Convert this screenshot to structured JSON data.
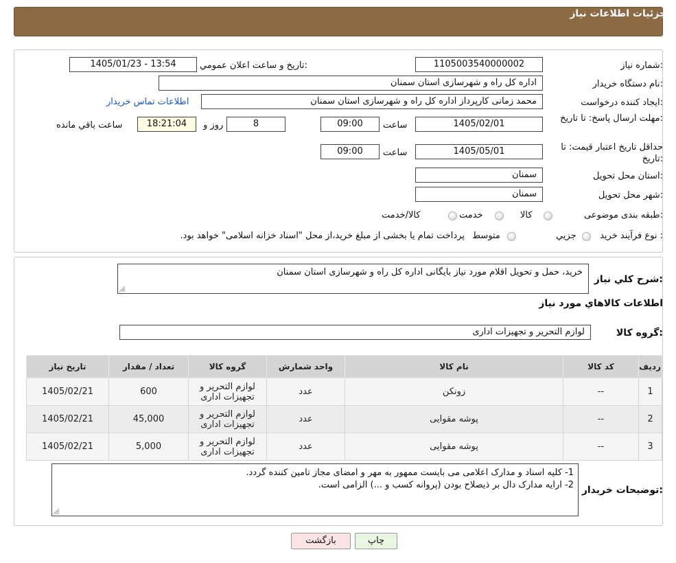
{
  "header": {
    "title": "جزئیات اطلاعات نیاز"
  },
  "info": {
    "need_number_label": "شماره نیاز:",
    "need_number": "1105003540000002",
    "announce_label": "تاریخ و ساعت اعلان عمومي:",
    "announce_value": "1405/01/23 - 13:54",
    "buyer_org_label": "نام دستگاه خريدار:",
    "buyer_org": "اداره کل راه و شهرسازی استان سمنان",
    "requester_label": "ايجاد کننده درخواست:",
    "requester": "محمد زمانی کارپرداز اداره کل راه و شهرسازی استان سمنان",
    "contact_link": "اطلاعات تماس خريدار",
    "deadline_label": "مهلت ارسال پاسخ: تا تاريخ:",
    "deadline_date": "1405/02/01",
    "time_label": "ساعت",
    "deadline_time": "09:00",
    "days_value": "8",
    "days_label": "روز و",
    "remaining_time": "18:21:04",
    "remaining_label": "ساعت باقي مانده",
    "validity_label": "حداقل تاريخ اعتبار قيمت: تا تاريخ:",
    "validity_date": "1405/05/01",
    "validity_time": "09:00",
    "province_label": "استان محل تحويل:",
    "province": "سمنان",
    "city_label": "شهر محل تحويل:",
    "city": "سمنان",
    "category_label": "طبقه بندی موضوعی:",
    "category_options": [
      "کالا",
      "خدمت",
      "کالا/خدمت"
    ],
    "process_label": "نوع فرآيند خريد :",
    "process_options": [
      "جزيي",
      "متوسط"
    ],
    "payment_note": "پرداخت تمام يا بخشی از مبلغ خريد،از محل \"اسناد خزانه اسلامی\" خواهد بود."
  },
  "details": {
    "description_label": "شرح کلي نياز:",
    "description": "خرید، حمل و تحویل اقلام مورد نیاز بایگانی اداره کل راه و شهرسازی استان سمنان",
    "goods_info_title": "اطلاعات کالاهاي مورد نياز",
    "goods_group_label": "گروه کالا:",
    "goods_group": "لوازم التحرير و تجهيزات اداری",
    "table": {
      "headers": [
        "رديف",
        "کد کالا",
        "نام کالا",
        "واحد شمارش",
        "گروه کالا",
        "تعداد / مقدار",
        "تاريخ نياز"
      ],
      "rows": [
        [
          "1",
          "--",
          "زونکن",
          "عدد",
          "لوازم التحرير و تجهيزات اداری",
          "600",
          "1405/02/21"
        ],
        [
          "2",
          "--",
          "پوشه مقوایی",
          "عدد",
          "لوازم التحرير و تجهيزات اداری",
          "45,000",
          "1405/02/21"
        ],
        [
          "3",
          "--",
          "پوشه مقوایی",
          "عدد",
          "لوازم التحرير و تجهيزات اداری",
          "5,000",
          "1405/02/21"
        ]
      ]
    },
    "buyer_notes_label": "توضيحات خريدار:",
    "buyer_notes_line1": "1- کلیه اسناد و مدارک اعلامی می بایست ممهور به مهر و امضای مجاز تامین کننده گردد.",
    "buyer_notes_line2": "2- ارایه مدارک دال بر ذیصلاح بودن (پروانه کسب و ...) الزامی است."
  },
  "buttons": {
    "print": "چاپ",
    "back": "بازگشت"
  },
  "colors": {
    "header_bg": "#8c6a44",
    "back_button_bg": "#fde4e4",
    "print_button_bg": "#e9f7e2"
  }
}
